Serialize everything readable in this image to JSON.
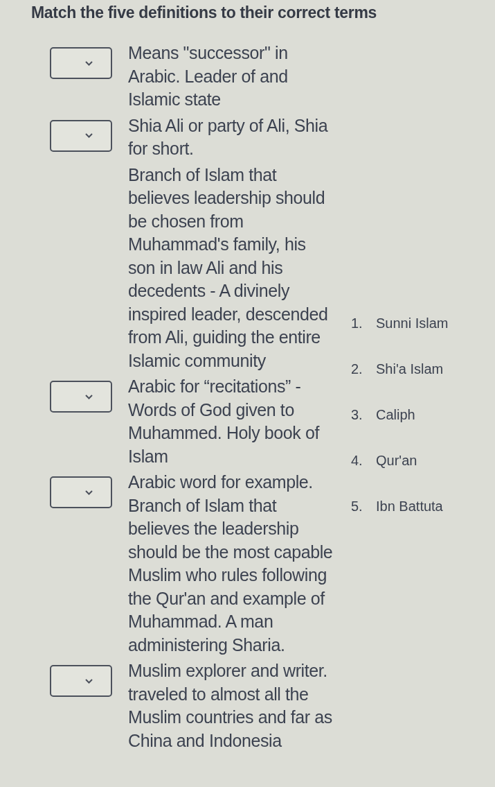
{
  "title": "Match the five definitions to their correct terms",
  "definitions": [
    {
      "kind": "dropdown",
      "text": "Means \"successor\" in Arabic. Leader of and Islamic state"
    },
    {
      "kind": "dropdown",
      "text": "Shia Ali or party of Ali, Shia for short."
    },
    {
      "kind": "plain",
      "text": "Branch of Islam that believes leadership should be chosen from Muhammad's family, his son in law Ali and his decedents - A divinely inspired leader, descended from Ali, guiding the entire Islamic community"
    },
    {
      "kind": "dropdown",
      "text": "Arabic for “recitations” - Words of God given to Muhammed. Holy book of Islam"
    },
    {
      "kind": "dropdown",
      "text": "Arabic word for example. Branch of Islam that believes the leadership should be the most capable Muslim who rules following the Qur'an and example of Muhammad. A man administering Sharia."
    },
    {
      "kind": "dropdown",
      "text": "Muslim explorer and writer. traveled to almost all the Muslim countries and far as China and Indonesia"
    }
  ],
  "terms": [
    {
      "number": "1.",
      "label": "Sunni Islam"
    },
    {
      "number": "2.",
      "label": "Shi'a Islam"
    },
    {
      "number": "3.",
      "label": "Caliph"
    },
    {
      "number": "4.",
      "label": "Qur'an"
    },
    {
      "number": "5.",
      "label": "Ibn Battuta"
    }
  ]
}
